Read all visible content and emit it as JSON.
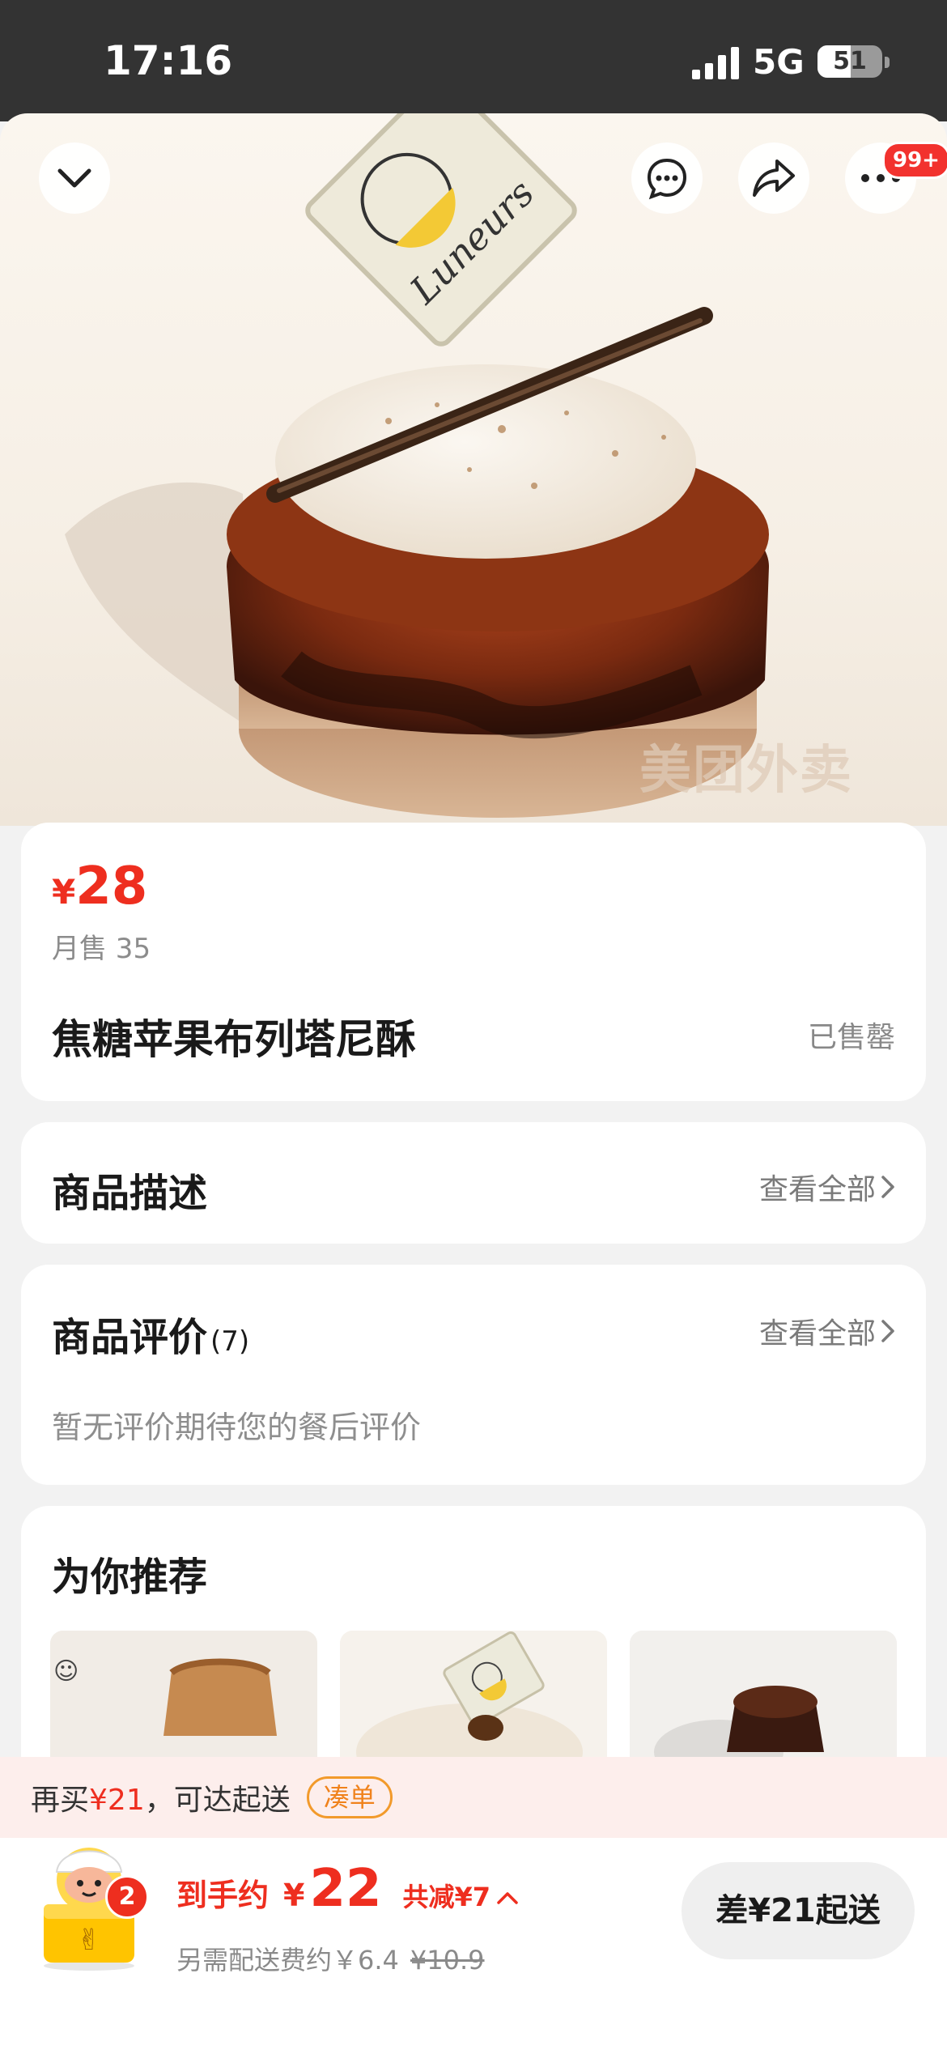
{
  "status_bar": {
    "time": "17:16",
    "network": "5G",
    "battery": "51",
    "battery_level_percent": 51
  },
  "hero": {
    "watermark": "美团外卖",
    "plaque_text": "Luneurs",
    "more_badge": "99+"
  },
  "product": {
    "currency": "¥",
    "price": "28",
    "monthly_sales": "月售 35",
    "name": "焦糖苹果布列塔尼酥",
    "stock_status": "已售罄"
  },
  "description_section": {
    "title": "商品描述",
    "view_all": "查看全部"
  },
  "reviews_section": {
    "title": "商品评价",
    "count": "(7)",
    "view_all": "查看全部",
    "empty_text": "暂无评价期待您的餐后评价"
  },
  "recommend_section": {
    "title": "为你推荐"
  },
  "promo": {
    "text_prefix": "再买",
    "amount": "¥21",
    "text_suffix": "，可达起送",
    "button": "凑单"
  },
  "bottom_bar": {
    "cart_count": "2",
    "pay_label": "到手约",
    "pay_currency": "¥",
    "pay_amount": "22",
    "discount": "共减¥7",
    "fee_text": "另需配送费约￥6.4",
    "fee_original": "¥10.9",
    "checkout_button": "差¥21起送"
  },
  "colors": {
    "accent_red": "#ee2e1f",
    "promo_orange": "#f0821b",
    "status_bar": "#333333"
  }
}
